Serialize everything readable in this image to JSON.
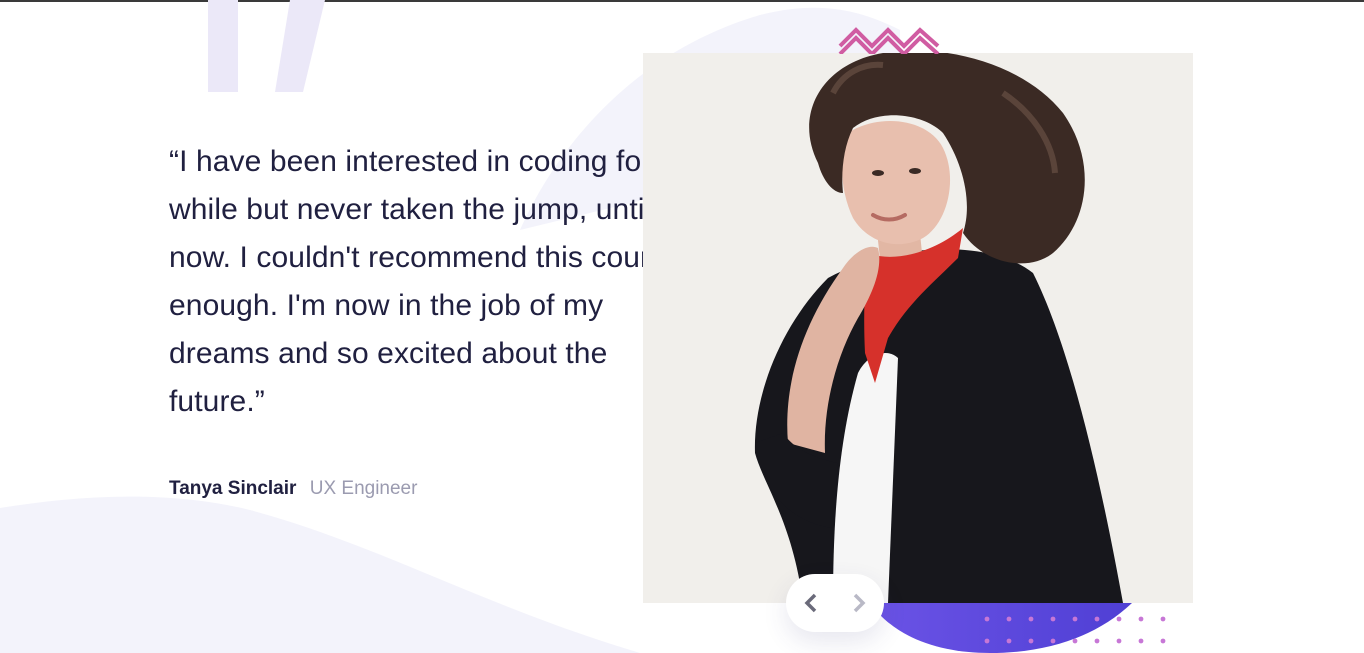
{
  "testimonial": {
    "quote": "“I have been interested in coding for a while but never taken the jump, until now. I couldn't recommend this course enough. I'm now in the job of my dreams and so excited about the future.”",
    "author_name": "Tanya Sinclair",
    "author_role": "UX Engineer"
  },
  "navigation": {
    "prev_icon": "chevron-left-icon",
    "next_icon": "chevron-right-icon"
  },
  "colors": {
    "text_dark": "#202040",
    "text_muted": "#9b9bb0",
    "accent_purple": "#5d4ae0",
    "accent_pink": "#d05ca2",
    "background_curve": "#f3f3fb"
  }
}
